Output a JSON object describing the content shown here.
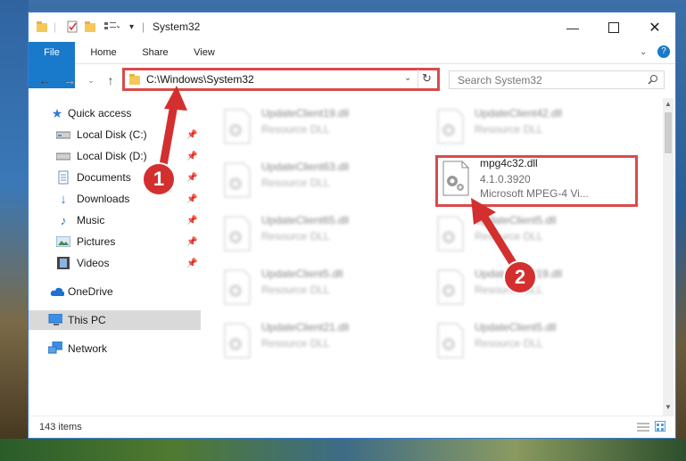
{
  "window": {
    "title": "System32"
  },
  "ribbon": {
    "tabs": [
      "File",
      "Home",
      "Share",
      "View"
    ]
  },
  "address": {
    "path": "C:\\Windows\\System32"
  },
  "search": {
    "placeholder": "Search System32"
  },
  "nav": {
    "items": [
      {
        "label": "Quick access",
        "icon": "star-icon",
        "pinned": false
      },
      {
        "label": "Local Disk (C:)",
        "icon": "drive-icon",
        "pinned": true
      },
      {
        "label": "Local Disk (D:)",
        "icon": "drive-icon",
        "pinned": true
      },
      {
        "label": "Documents",
        "icon": "documents-icon",
        "pinned": true
      },
      {
        "label": "Downloads",
        "icon": "download-icon",
        "pinned": true
      },
      {
        "label": "Music",
        "icon": "music-icon",
        "pinned": true
      },
      {
        "label": "Pictures",
        "icon": "pictures-icon",
        "pinned": true
      },
      {
        "label": "Videos",
        "icon": "videos-icon",
        "pinned": true
      },
      {
        "label": "OneDrive",
        "icon": "cloud-icon",
        "pinned": false
      },
      {
        "label": "This PC",
        "icon": "computer-icon",
        "pinned": false
      },
      {
        "label": "Network",
        "icon": "network-icon",
        "pinned": false
      }
    ]
  },
  "files": {
    "left": [
      {
        "name": "UpdateClient19.dll",
        "type": "Resource DLL"
      },
      {
        "name": "UpdateClient63.dll",
        "type": "Resource DLL"
      },
      {
        "name": "UpdateClient65.dll",
        "type": "Resource DLL"
      },
      {
        "name": "UpdateClient5.dll",
        "type": "Resource DLL"
      },
      {
        "name": "UpdateClient21.dll",
        "type": "Resource DLL"
      }
    ],
    "right": [
      {
        "name": "UpdateClient42.dll",
        "type": "Resource DLL"
      },
      {
        "name": "mpg4c32.dll",
        "version": "4.1.0.3920",
        "description": "Microsoft MPEG-4 Vi...",
        "highlighted": true
      },
      {
        "name": "UpdateClient5.dll",
        "type": "Resource DLL"
      },
      {
        "name": "UpdateClient19.dll",
        "type": "Resource DLL"
      },
      {
        "name": "UpdateClient5.dll",
        "type": "Resource DLL"
      }
    ]
  },
  "status": {
    "item_count": "143 items"
  },
  "annotations": {
    "step1": "1",
    "step2": "2",
    "color": "#d32f2f"
  }
}
